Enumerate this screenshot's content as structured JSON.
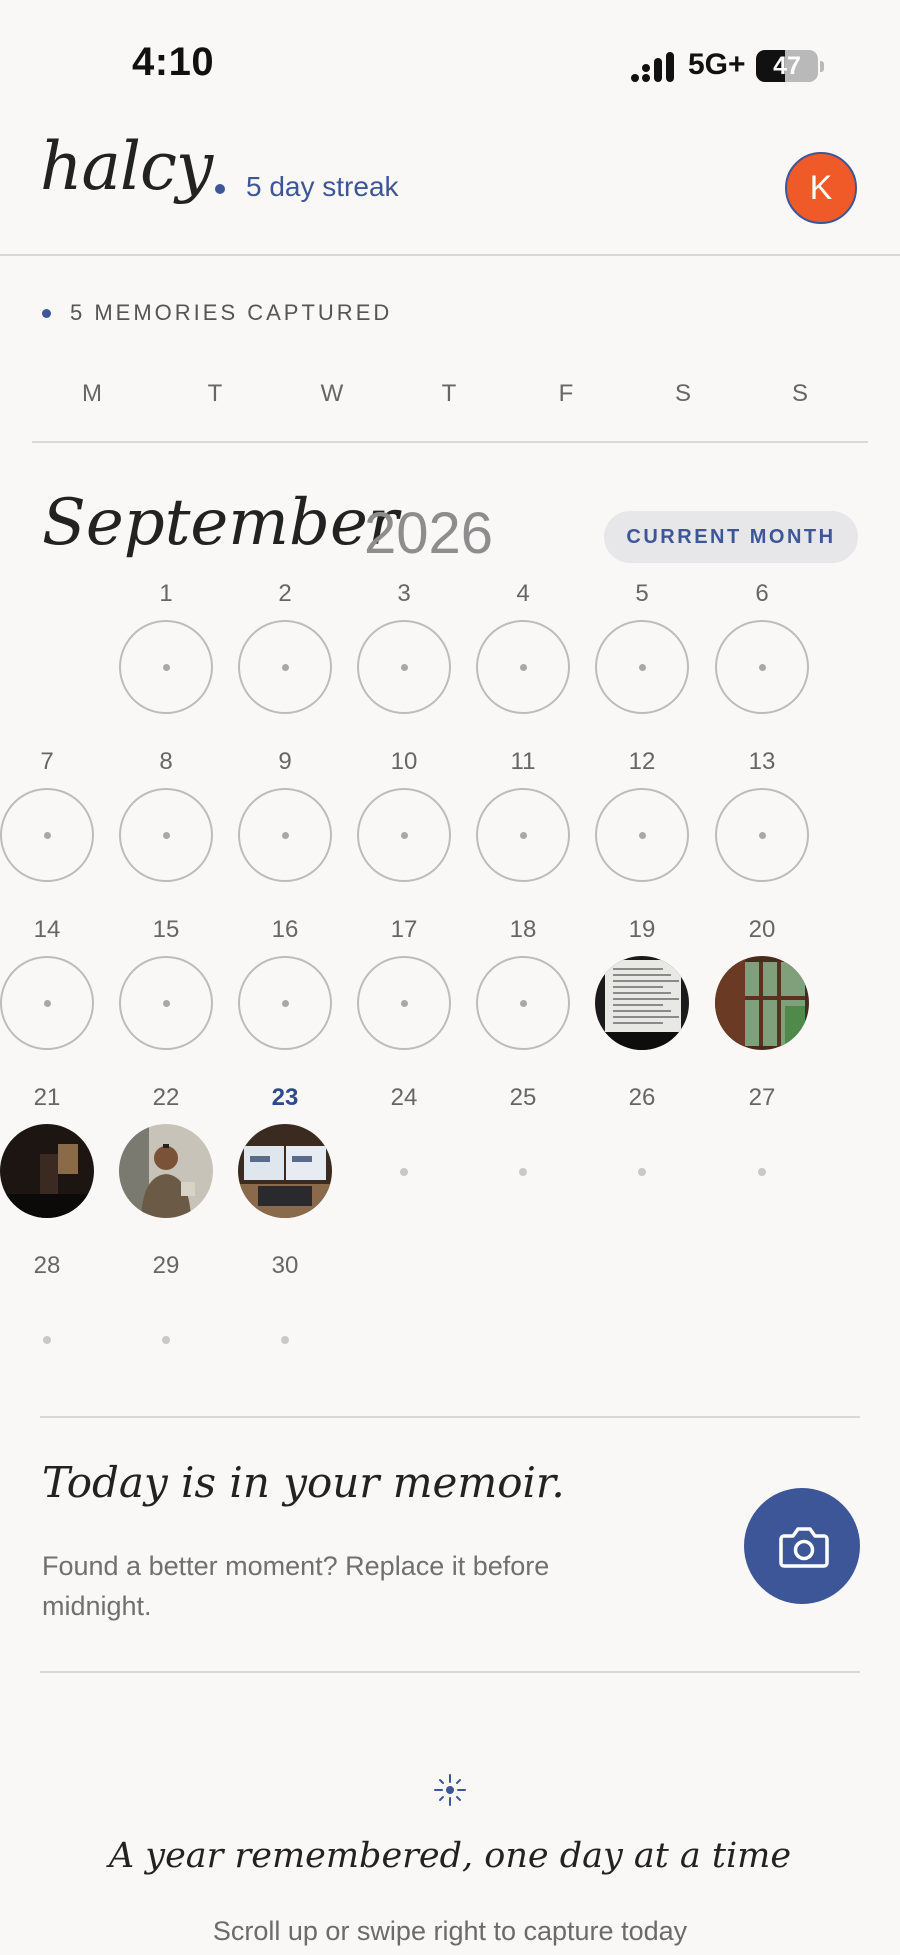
{
  "status": {
    "time": "4:10",
    "network": "5G+",
    "battery": "47",
    "battery_level": 0.47
  },
  "header": {
    "logo": "halcy",
    "streak": "5 day streak",
    "avatar_initial": "K"
  },
  "memories_captured": "5 MEMORIES CAPTURED",
  "weekdays": [
    "M",
    "T",
    "W",
    "T",
    "F",
    "S",
    "S"
  ],
  "month": {
    "name": "September",
    "year": "2026",
    "badge": "CURRENT MONTH"
  },
  "days": [
    {
      "num": "1",
      "state": "empty"
    },
    {
      "num": "2",
      "state": "empty"
    },
    {
      "num": "3",
      "state": "empty"
    },
    {
      "num": "4",
      "state": "empty"
    },
    {
      "num": "5",
      "state": "empty"
    },
    {
      "num": "6",
      "state": "empty"
    },
    {
      "num": "7",
      "state": "empty"
    },
    {
      "num": "8",
      "state": "empty"
    },
    {
      "num": "9",
      "state": "empty"
    },
    {
      "num": "10",
      "state": "empty"
    },
    {
      "num": "11",
      "state": "empty"
    },
    {
      "num": "12",
      "state": "empty"
    },
    {
      "num": "13",
      "state": "empty"
    },
    {
      "num": "14",
      "state": "empty"
    },
    {
      "num": "15",
      "state": "empty"
    },
    {
      "num": "16",
      "state": "empty"
    },
    {
      "num": "17",
      "state": "empty"
    },
    {
      "num": "18",
      "state": "empty"
    },
    {
      "num": "19",
      "state": "photo",
      "photo": "document-photo"
    },
    {
      "num": "20",
      "state": "photo",
      "photo": "window-photo"
    },
    {
      "num": "21",
      "state": "photo",
      "photo": "dark-room-photo"
    },
    {
      "num": "22",
      "state": "photo",
      "photo": "person-photo"
    },
    {
      "num": "23",
      "state": "photo",
      "photo": "laptop-photo",
      "today": true
    },
    {
      "num": "24",
      "state": "future"
    },
    {
      "num": "25",
      "state": "future"
    },
    {
      "num": "26",
      "state": "future"
    },
    {
      "num": "27",
      "state": "future"
    },
    {
      "num": "28",
      "state": "future"
    },
    {
      "num": "29",
      "state": "future"
    },
    {
      "num": "30",
      "state": "future"
    }
  ],
  "today_card": {
    "title": "Today is in your memoir.",
    "subtitle": "Found a better moment? Replace it before midnight.",
    "button_icon": "camera-icon"
  },
  "footer": {
    "icon": "sparkle-icon",
    "title": "A year remembered, one day at a time",
    "subtitle": "Scroll up or swipe right to capture today"
  },
  "colors": {
    "accent": "#3d5697",
    "avatar": "#f05a28",
    "background": "#f9f8f6"
  }
}
